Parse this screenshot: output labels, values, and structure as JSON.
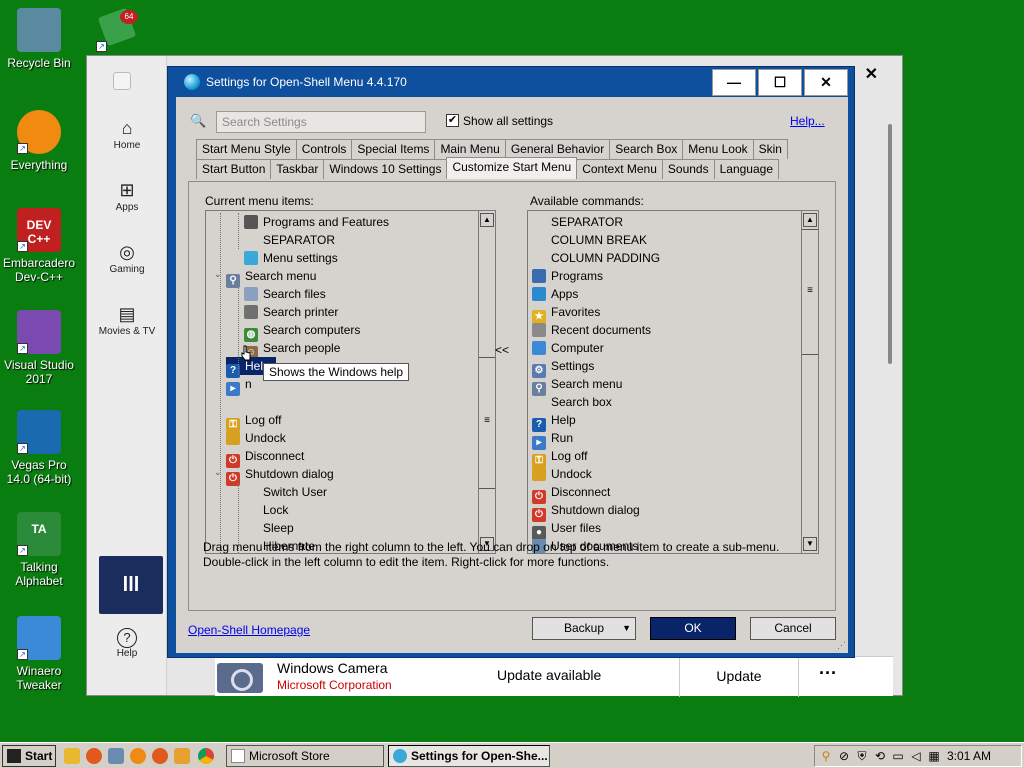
{
  "desktop": {
    "icons": [
      {
        "label": "Recycle Bin",
        "icon": "recycle-bin-icon"
      },
      {
        "label": "Everything",
        "icon": "magnifier-icon"
      },
      {
        "label": "Embarcadero Dev-C++",
        "icon": "devcpp-icon",
        "badge": "DEV C++"
      },
      {
        "label": "Visual Studio 2017",
        "icon": "visual-studio-icon"
      },
      {
        "label": "Vegas Pro 14.0 (64-bit)",
        "icon": "vegas-icon"
      },
      {
        "label": "Talking Alphabet",
        "icon": "talking-alphabet-icon",
        "badge": "TA"
      },
      {
        "label": "Winaero Tweaker",
        "icon": "winaero-icon"
      }
    ]
  },
  "store": {
    "nav": [
      {
        "label": "Home",
        "icon": "home-icon"
      },
      {
        "label": "Apps",
        "icon": "apps-icon"
      },
      {
        "label": "Gaming",
        "icon": "gamepad-icon"
      },
      {
        "label": "Movies & TV",
        "icon": "film-icon"
      },
      {
        "label": "Help",
        "icon": "help-icon"
      }
    ],
    "close_glyph": "✕",
    "app_row": {
      "title": "Windows Camera",
      "publisher": "Microsoft Corporation",
      "status": "Update available",
      "action": "Update",
      "more": "···"
    }
  },
  "dialog": {
    "title": "Settings for Open-Shell Menu 4.4.170",
    "controls": {
      "minimize": "—",
      "maximize": "☐",
      "close": "✕"
    },
    "search_placeholder": "Search Settings",
    "show_all_label": "Show all settings",
    "show_all_checked": "✔",
    "help_link": "Help...",
    "tabs_row1": [
      "Start Menu Style",
      "Controls",
      "Special Items",
      "Main Menu",
      "General Behavior",
      "Search Box",
      "Menu Look",
      "Skin"
    ],
    "tabs_row2": [
      "Start Button",
      "Taskbar",
      "Windows 10 Settings",
      "Customize Start Menu",
      "Context Menu",
      "Sounds",
      "Language"
    ],
    "active_tab": "Customize Start Menu",
    "current_label": "Current menu items:",
    "available_label": "Available commands:",
    "current_items": [
      {
        "label": "Programs and Features",
        "icon": "programs-features-icon",
        "color": "#555555",
        "level": 2
      },
      {
        "label": "SEPARATOR",
        "icon": "",
        "color": "",
        "level": 2
      },
      {
        "label": "Menu settings",
        "icon": "menu-settings-icon",
        "color": "#3aa8d8",
        "level": 2
      },
      {
        "label": "Search menu",
        "icon": "search-icon",
        "color": "#6a7fa0",
        "level": 1,
        "expanded": true
      },
      {
        "label": "Search files",
        "icon": "file-icon",
        "color": "#8aa0c0",
        "level": 2
      },
      {
        "label": "Search printer",
        "icon": "printer-icon",
        "color": "#707070",
        "level": 2
      },
      {
        "label": "Search computers",
        "icon": "globe-icon",
        "color": "#3a8a3a",
        "level": 2
      },
      {
        "label": "Search people",
        "icon": "people-icon",
        "color": "#8a6a4a",
        "level": 2
      },
      {
        "label": "Help",
        "icon": "help-icon",
        "color": "#1a5cb0",
        "level": 1,
        "selected": true
      },
      {
        "label": "n",
        "icon": "run-icon",
        "color": "#3a7ac8",
        "level": 1
      },
      {
        "label": "",
        "icon": "",
        "color": "",
        "level": 1
      },
      {
        "label": "Log off",
        "icon": "key-icon",
        "color": "#d8a020",
        "level": 1
      },
      {
        "label": "Undock",
        "icon": "undock-icon",
        "color": "#d8a020",
        "level": 1
      },
      {
        "label": "Disconnect",
        "icon": "power-icon",
        "color": "#d03a2a",
        "level": 1
      },
      {
        "label": "Shutdown dialog",
        "icon": "power-icon",
        "color": "#d03a2a",
        "level": 1,
        "expanded": true
      },
      {
        "label": "Switch User",
        "icon": "",
        "color": "",
        "level": 2
      },
      {
        "label": "Lock",
        "icon": "",
        "color": "",
        "level": 2
      },
      {
        "label": "Sleep",
        "icon": "",
        "color": "",
        "level": 2
      },
      {
        "label": "Hibernate",
        "icon": "",
        "color": "",
        "level": 2
      }
    ],
    "available_items": [
      {
        "label": "SEPARATOR",
        "icon": "",
        "color": ""
      },
      {
        "label": "COLUMN BREAK",
        "icon": "",
        "color": ""
      },
      {
        "label": "COLUMN PADDING",
        "icon": "",
        "color": ""
      },
      {
        "label": "Programs",
        "icon": "programs-icon",
        "color": "#3a6ab0"
      },
      {
        "label": "Apps",
        "icon": "apps-icon",
        "color": "#2a8ad0"
      },
      {
        "label": "Favorites",
        "icon": "star-icon",
        "color": "#e0b020"
      },
      {
        "label": "Recent documents",
        "icon": "document-icon",
        "color": "#8a8a8a"
      },
      {
        "label": "Computer",
        "icon": "computer-icon",
        "color": "#3a8ad8"
      },
      {
        "label": "Settings",
        "icon": "settings-icon",
        "color": "#5a7ab0"
      },
      {
        "label": "Search menu",
        "icon": "search-icon",
        "color": "#6a7fa0"
      },
      {
        "label": "Search box",
        "icon": "",
        "color": ""
      },
      {
        "label": "Help",
        "icon": "help-icon",
        "color": "#1a5cb0"
      },
      {
        "label": "Run",
        "icon": "run-icon",
        "color": "#3a7ac8"
      },
      {
        "label": "Log off",
        "icon": "key-icon",
        "color": "#d8a020"
      },
      {
        "label": "Undock",
        "icon": "undock-icon",
        "color": "#d8a020"
      },
      {
        "label": "Disconnect",
        "icon": "power-icon",
        "color": "#d03a2a"
      },
      {
        "label": "Shutdown dialog",
        "icon": "power-icon",
        "color": "#d03a2a"
      },
      {
        "label": "User files",
        "icon": "user-icon",
        "color": "#5a5a5a"
      },
      {
        "label": "User documents",
        "icon": "document-icon",
        "color": "#6a8ab0"
      }
    ],
    "tooltip": "Shows the Windows help",
    "move_left": "<<",
    "hint_line1": "Drag menu items from the right column to the left. You can drop on top of a menu item to create a sub-menu.",
    "hint_line2": "Double-click in the left column to edit the item. Right-click for more functions.",
    "homepage_link": "Open-Shell Homepage",
    "backup_label": "Backup",
    "ok_label": "OK",
    "cancel_label": "Cancel"
  },
  "taskbar": {
    "start_label": "Start",
    "tasks": [
      {
        "label": "Microsoft Store",
        "active": false
      },
      {
        "label": "Settings for Open-She...",
        "active": true
      }
    ],
    "clock": "3:01 AM"
  }
}
